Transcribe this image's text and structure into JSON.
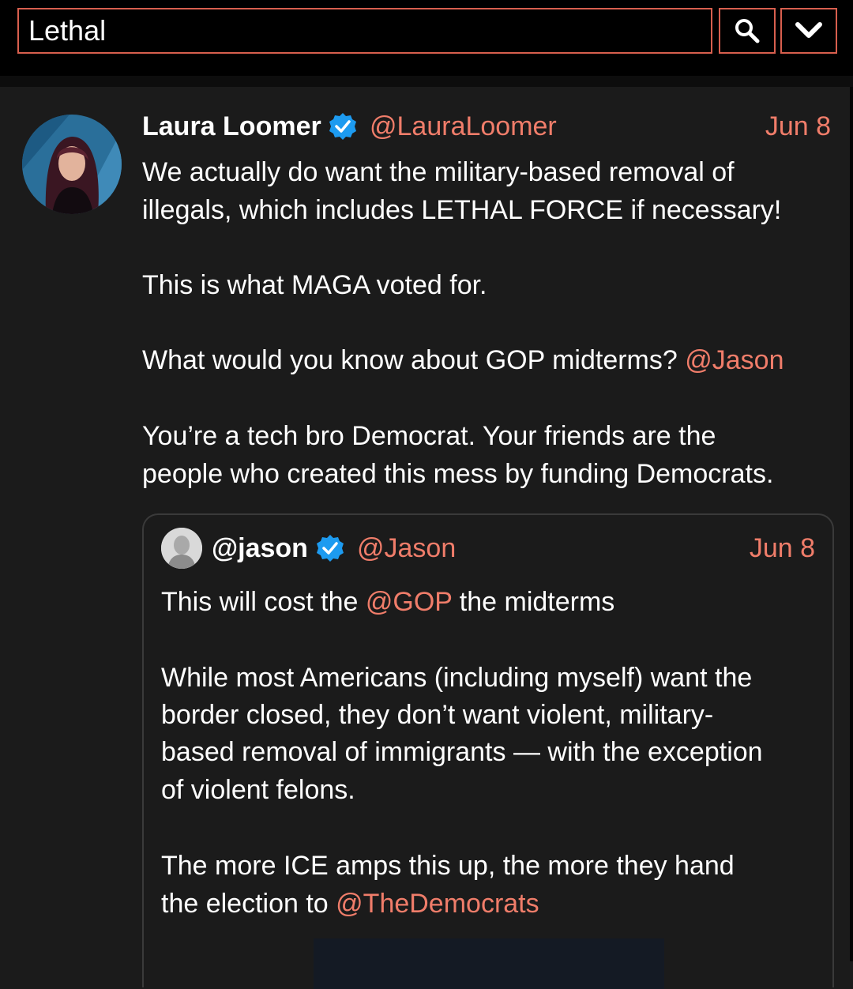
{
  "search": {
    "value": "Lethal",
    "search_icon": "search-icon",
    "dropdown_icon": "chevron-down-icon"
  },
  "post": {
    "author_name": "Laura Loomer",
    "handle": "@LauraLoomer",
    "date": "Jun 8",
    "verified_icon": "verified-badge-icon",
    "lines": [
      "We actually do want the military-based removal of",
      "illegals, which includes LETHAL FORCE if necessary!",
      "This is what MAGA voted for.",
      "What would you know about GOP midterms?",
      "You’re a tech bro Democrat. Your friends are the",
      "people who created this mess by funding Democrats."
    ],
    "mention_jason": "@Jason"
  },
  "quote": {
    "author_name": "@jason",
    "handle": "@Jason",
    "date": "Jun 8",
    "verified_icon": "verified-badge-icon",
    "line1_pre": "This will cost the",
    "line1_mention": "@GOP",
    "line1_post": "the midterms",
    "para2": [
      "While most Americans (including myself) want the",
      "border closed, they don’t want violent, military-",
      "based removal of immigrants — with the exception",
      "of violent felons."
    ],
    "para3_line1": "The more ICE amps this up, the more they hand",
    "para3_line2_pre": "the election to",
    "para3_line2_mention": "@TheDemocrats"
  },
  "colors": {
    "accent": "#f07d6a",
    "border_accent": "#d85f4e",
    "background": "#1b1b1b",
    "verified": "#1d9bf0"
  }
}
